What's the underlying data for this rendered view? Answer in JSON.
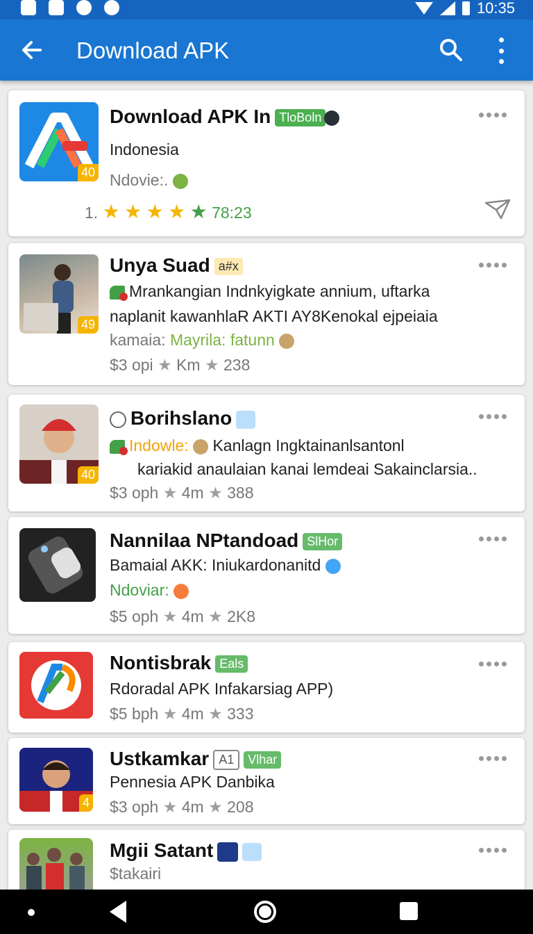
{
  "status_bar": {
    "time": "10:35"
  },
  "app_bar": {
    "title": "Download APK"
  },
  "cards": [
    {
      "title": "Download APK In",
      "tag": "TloBoln",
      "line1": "Indonesia",
      "line2": "Ndovie:.",
      "rating_prefix": "1.",
      "rating_value": "78:23",
      "badge": "40"
    },
    {
      "title": "Unya Suad",
      "tag": "a#x",
      "line1": "Mrankangian Indnkyigkate annium, uftarka",
      "line2": "naplanit kawanhlaR AKTI AY8Kenokal ejpeiaia",
      "line3_label": "kamaia:",
      "line3_value": "Mayrila: fatunn",
      "stats": {
        "price": "$3 opi",
        "mid": "Km",
        "count": "238"
      },
      "badge": "49"
    },
    {
      "title": "Borihslano",
      "line1_label": "Indowle:",
      "line1": "Kanlagn Ingktainanlsantonl",
      "line2": "kariakid anaulaian  kanai  lemdeai Sakainclarsia..",
      "stats": {
        "price": "$3 oph",
        "mid": "4m",
        "count": "388"
      },
      "badge": "40"
    },
    {
      "title": "Nannilaa NPtandoad",
      "tag": "SlHor",
      "line1": "Bamaial AKK: Iniukardonanitd",
      "line2": "Ndoviar:",
      "stats": {
        "price": "$5 oph",
        "mid": "4m",
        "count": "2K8"
      }
    },
    {
      "title": "Nontisbrak",
      "tag": "Eals",
      "line1": "Rdoradal APK Infakarsiag APP)",
      "stats": {
        "price": "$5 bph",
        "mid": "4m",
        "count": "333"
      }
    },
    {
      "title": "Ustkamkar",
      "tag_a": "A1",
      "tag": "Vlhar",
      "line1": "Pennesia APK Danbika",
      "stats": {
        "price": "$3 oph",
        "mid": "4m",
        "count": "208"
      },
      "badge": "4"
    },
    {
      "title": "Mgii Satant",
      "line1": "$takairi"
    }
  ],
  "colors": {
    "primary": "#1976d2",
    "status": "#1565c0",
    "star": "#f5b400",
    "green": "#43a047"
  }
}
